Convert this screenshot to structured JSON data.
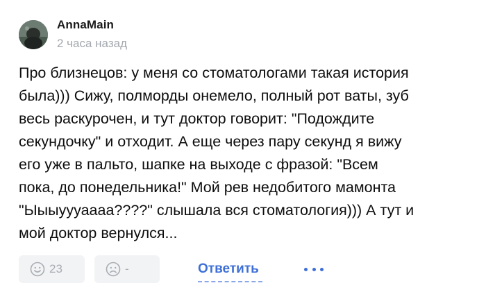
{
  "comment": {
    "author": "AnnaMain",
    "time": "2 часа назад",
    "text": "Про близнецов: у меня со стоматологами такая история\nбыла))) Сижу, полморды онемело, полный рот ваты, зуб\nвесь раскурочен, и тут доктор говорит: \"Подождите\nсекундочку\" и отходит. А еще через пару секунд я вижу\nего уже в пальто, шапке на выходе с фразой: \"Всем\nпока, до понедельника!\" Мой рев недобитого мамонта\n\"Ыыыуууаааа????\" слышала вся стоматология))) А тут и\nмой доктор вернулся..."
  },
  "actions": {
    "like_icon": "smile-icon",
    "like_count": "23",
    "dislike_icon": "frown-icon",
    "dislike_count": "-",
    "reply_label": "Ответить",
    "more_icon": "more-dots-icon"
  },
  "colors": {
    "accent": "#3d6fd6",
    "muted": "#a3a8ad",
    "button_bg": "#f2f3f5"
  }
}
